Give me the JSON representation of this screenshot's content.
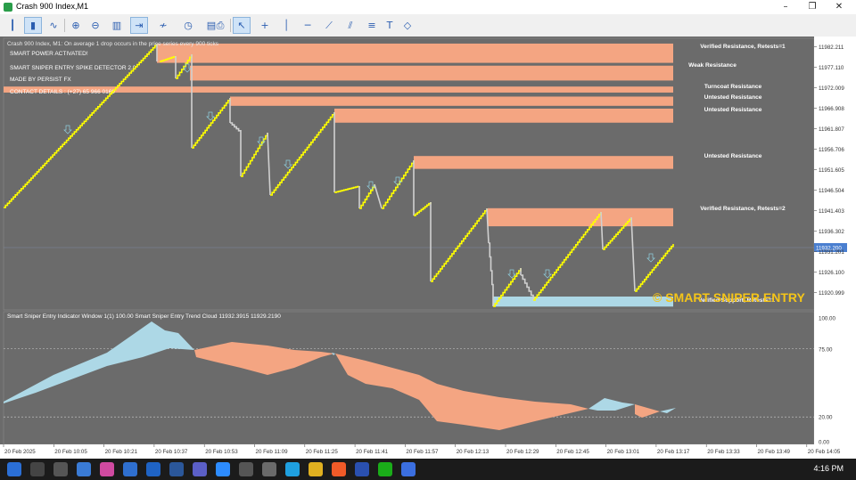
{
  "window": {
    "title": "Crash 900 Index,M1",
    "controls": [
      "–",
      "❐",
      "✕"
    ]
  },
  "toolbar": {
    "icons": [
      "bar-chart-icon",
      "candles-icon",
      "line-chart-icon",
      "zoom-in-icon",
      "zoom-out-icon",
      "grid-icon",
      "autoscroll-icon",
      "indicators-icon",
      "period-icon",
      "templates-icon",
      "screenshot-icon",
      "cursor-icon",
      "crosshair-icon",
      "vertical-line-icon",
      "horizontal-line-icon",
      "trendline-icon",
      "channel-icon",
      "text-icon",
      "shapes-icon"
    ]
  },
  "overlay": {
    "header_line": "Crash 900 Index, M1:  On average 1 drop occurs in the price series every 900 ticks",
    "lines": [
      "SMART POWER ACTIVATED!",
      "SMART SNIPER ENTRY SPIKE DETECTOR 2.0",
      "MADE BY PERSIST FX",
      "CONTACT DETAILS : (+27) 65 966 0169"
    ],
    "watermark": "© SMART SNIPER ENTRY"
  },
  "zones": [
    {
      "label": "Verified Resistance, Retests=1",
      "price_top": 11983.0,
      "price_bottom": 11978.2
    },
    {
      "label": "Weak Resistance",
      "price_top": 11977.5,
      "price_bottom": 11973.8
    },
    {
      "label": "Turncoat Resistance",
      "price_top": 11972.3,
      "price_bottom": 11970.8
    },
    {
      "label": "Untested Resistance",
      "price_top": 11969.8,
      "price_bottom": 11967.5
    },
    {
      "label": "Untested Resistance",
      "price_top": 11966.8,
      "price_bottom": 11963.3
    },
    {
      "label": "Untested Resistance",
      "price_top": 11955.0,
      "price_bottom": 11951.8
    },
    {
      "label": "Verified Resistance, Retests=2",
      "price_top": 11942.0,
      "price_bottom": 11937.5
    },
    {
      "label": "Verified Support, Retests=1",
      "price_top": 11920.0,
      "price_bottom": 11917.5,
      "color": "#add8e6"
    }
  ],
  "price_axis": {
    "ticks": [
      "11982.211",
      "11977.110",
      "11972.009",
      "11966.908",
      "11961.807",
      "11956.706",
      "11951.605",
      "11946.504",
      "11941.403",
      "11936.302",
      "11931.201",
      "11926.100",
      "11920.999"
    ],
    "current_price": "11932.200"
  },
  "indicator": {
    "header": "Smart Sniper Entry Indicator Window 1(1) 100.00  Smart Sniper Entry Trend Cloud  11932.3915  11929.2190",
    "ticks": [
      "100.00",
      "75.00",
      "20.00",
      "0.00"
    ],
    "colors": {
      "up": "#add8e6",
      "down": "#f4a582"
    }
  },
  "time_axis": [
    "20 Feb 2025",
    "20 Feb 10:05",
    "20 Feb 10:21",
    "20 Feb 10:37",
    "20 Feb 10:53",
    "20 Feb 11:09",
    "20 Feb 11:25",
    "20 Feb 11:41",
    "20 Feb 11:57",
    "20 Feb 12:13",
    "20 Feb 12:29",
    "20 Feb 12:45",
    "20 Feb 13:01",
    "20 Feb 13:17",
    "20 Feb 13:33",
    "20 Feb 13:49",
    "20 Feb 14:05"
  ],
  "taskbar": {
    "clock": "4:16 PM",
    "icons": [
      "windows-start-icon",
      "search-icon",
      "task-view-icon",
      "widgets-icon",
      "copilot-icon",
      "store-icon",
      "mail-icon",
      "word-icon",
      "teams-icon",
      "zoom-icon",
      "media-icon",
      "settings-icon",
      "edge-icon",
      "chrome-icon",
      "photos-icon",
      "mt5-icon",
      "wechat-icon",
      "files-icon"
    ]
  },
  "colors": {
    "chart_bg": "#6b6b6b",
    "zone": "#f4a582",
    "support": "#add8e6",
    "rise": "#ffff00",
    "drop": "#d0d0d0",
    "watermark": "#f5c518"
  }
}
